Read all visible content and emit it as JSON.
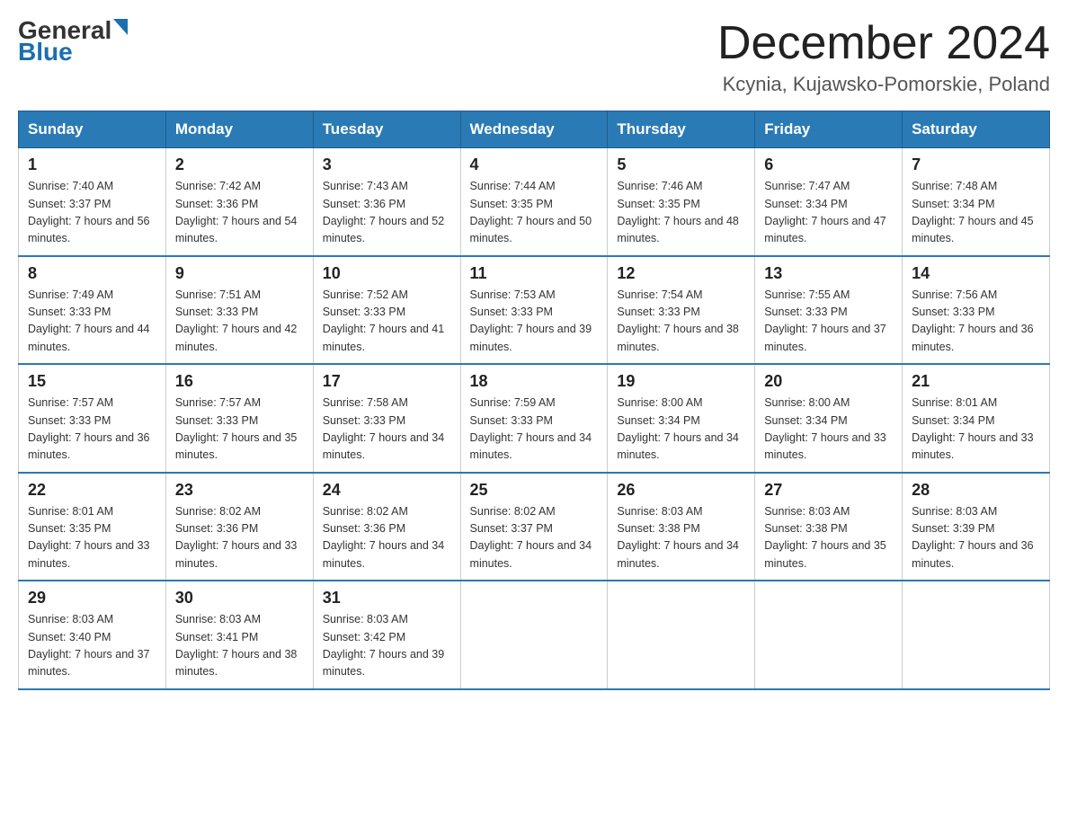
{
  "header": {
    "logo": {
      "general": "General",
      "blue": "Blue"
    },
    "title": "December 2024",
    "subtitle": "Kcynia, Kujawsko-Pomorskie, Poland"
  },
  "days_of_week": [
    "Sunday",
    "Monday",
    "Tuesday",
    "Wednesday",
    "Thursday",
    "Friday",
    "Saturday"
  ],
  "weeks": [
    [
      {
        "day": "1",
        "sunrise": "7:40 AM",
        "sunset": "3:37 PM",
        "daylight": "7 hours and 56 minutes."
      },
      {
        "day": "2",
        "sunrise": "7:42 AM",
        "sunset": "3:36 PM",
        "daylight": "7 hours and 54 minutes."
      },
      {
        "day": "3",
        "sunrise": "7:43 AM",
        "sunset": "3:36 PM",
        "daylight": "7 hours and 52 minutes."
      },
      {
        "day": "4",
        "sunrise": "7:44 AM",
        "sunset": "3:35 PM",
        "daylight": "7 hours and 50 minutes."
      },
      {
        "day": "5",
        "sunrise": "7:46 AM",
        "sunset": "3:35 PM",
        "daylight": "7 hours and 48 minutes."
      },
      {
        "day": "6",
        "sunrise": "7:47 AM",
        "sunset": "3:34 PM",
        "daylight": "7 hours and 47 minutes."
      },
      {
        "day": "7",
        "sunrise": "7:48 AM",
        "sunset": "3:34 PM",
        "daylight": "7 hours and 45 minutes."
      }
    ],
    [
      {
        "day": "8",
        "sunrise": "7:49 AM",
        "sunset": "3:33 PM",
        "daylight": "7 hours and 44 minutes."
      },
      {
        "day": "9",
        "sunrise": "7:51 AM",
        "sunset": "3:33 PM",
        "daylight": "7 hours and 42 minutes."
      },
      {
        "day": "10",
        "sunrise": "7:52 AM",
        "sunset": "3:33 PM",
        "daylight": "7 hours and 41 minutes."
      },
      {
        "day": "11",
        "sunrise": "7:53 AM",
        "sunset": "3:33 PM",
        "daylight": "7 hours and 39 minutes."
      },
      {
        "day": "12",
        "sunrise": "7:54 AM",
        "sunset": "3:33 PM",
        "daylight": "7 hours and 38 minutes."
      },
      {
        "day": "13",
        "sunrise": "7:55 AM",
        "sunset": "3:33 PM",
        "daylight": "7 hours and 37 minutes."
      },
      {
        "day": "14",
        "sunrise": "7:56 AM",
        "sunset": "3:33 PM",
        "daylight": "7 hours and 36 minutes."
      }
    ],
    [
      {
        "day": "15",
        "sunrise": "7:57 AM",
        "sunset": "3:33 PM",
        "daylight": "7 hours and 36 minutes."
      },
      {
        "day": "16",
        "sunrise": "7:57 AM",
        "sunset": "3:33 PM",
        "daylight": "7 hours and 35 minutes."
      },
      {
        "day": "17",
        "sunrise": "7:58 AM",
        "sunset": "3:33 PM",
        "daylight": "7 hours and 34 minutes."
      },
      {
        "day": "18",
        "sunrise": "7:59 AM",
        "sunset": "3:33 PM",
        "daylight": "7 hours and 34 minutes."
      },
      {
        "day": "19",
        "sunrise": "8:00 AM",
        "sunset": "3:34 PM",
        "daylight": "7 hours and 34 minutes."
      },
      {
        "day": "20",
        "sunrise": "8:00 AM",
        "sunset": "3:34 PM",
        "daylight": "7 hours and 33 minutes."
      },
      {
        "day": "21",
        "sunrise": "8:01 AM",
        "sunset": "3:34 PM",
        "daylight": "7 hours and 33 minutes."
      }
    ],
    [
      {
        "day": "22",
        "sunrise": "8:01 AM",
        "sunset": "3:35 PM",
        "daylight": "7 hours and 33 minutes."
      },
      {
        "day": "23",
        "sunrise": "8:02 AM",
        "sunset": "3:36 PM",
        "daylight": "7 hours and 33 minutes."
      },
      {
        "day": "24",
        "sunrise": "8:02 AM",
        "sunset": "3:36 PM",
        "daylight": "7 hours and 34 minutes."
      },
      {
        "day": "25",
        "sunrise": "8:02 AM",
        "sunset": "3:37 PM",
        "daylight": "7 hours and 34 minutes."
      },
      {
        "day": "26",
        "sunrise": "8:03 AM",
        "sunset": "3:38 PM",
        "daylight": "7 hours and 34 minutes."
      },
      {
        "day": "27",
        "sunrise": "8:03 AM",
        "sunset": "3:38 PM",
        "daylight": "7 hours and 35 minutes."
      },
      {
        "day": "28",
        "sunrise": "8:03 AM",
        "sunset": "3:39 PM",
        "daylight": "7 hours and 36 minutes."
      }
    ],
    [
      {
        "day": "29",
        "sunrise": "8:03 AM",
        "sunset": "3:40 PM",
        "daylight": "7 hours and 37 minutes."
      },
      {
        "day": "30",
        "sunrise": "8:03 AM",
        "sunset": "3:41 PM",
        "daylight": "7 hours and 38 minutes."
      },
      {
        "day": "31",
        "sunrise": "8:03 AM",
        "sunset": "3:42 PM",
        "daylight": "7 hours and 39 minutes."
      },
      null,
      null,
      null,
      null
    ]
  ]
}
